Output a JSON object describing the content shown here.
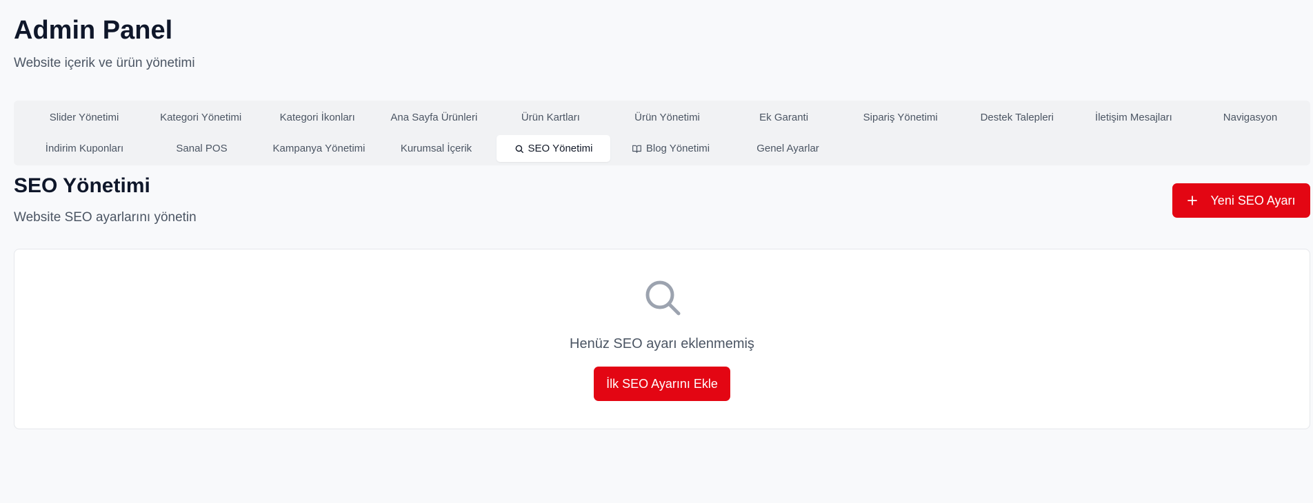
{
  "header": {
    "title": "Admin Panel",
    "subtitle": "Website içerik ve ürün yönetimi"
  },
  "tabs": {
    "row1": [
      {
        "label": "Slider Yönetimi"
      },
      {
        "label": "Kategori Yönetimi"
      },
      {
        "label": "Kategori İkonları"
      },
      {
        "label": "Ana Sayfa Ürünleri"
      },
      {
        "label": "Ürün Kartları"
      },
      {
        "label": "Ürün Yönetimi"
      },
      {
        "label": "Ek Garanti"
      },
      {
        "label": "Sipariş Yönetimi"
      },
      {
        "label": "Destek Talepleri"
      },
      {
        "label": "İletişim Mesajları"
      },
      {
        "label": "Navigasyon"
      }
    ],
    "row2": [
      {
        "label": "İndirim Kuponları"
      },
      {
        "label": "Sanal POS"
      },
      {
        "label": "Kampanya Yönetimi"
      },
      {
        "label": "Kurumsal İçerik"
      },
      {
        "label": "SEO Yönetimi",
        "icon": "search-icon",
        "active": true
      },
      {
        "label": "Blog Yönetimi",
        "icon": "book-icon"
      },
      {
        "label": "Genel Ayarlar"
      }
    ]
  },
  "section": {
    "title": "SEO Yönetimi",
    "subtitle": "Website SEO ayarlarını yönetin",
    "new_button_label": "Yeni SEO Ayarı",
    "new_button_icon": "plus-icon"
  },
  "empty_state": {
    "icon": "search-icon",
    "message": "Henüz SEO ayarı eklenmemiş",
    "button_label": "İlk SEO Ayarını Ekle"
  },
  "colors": {
    "accent": "#e30613",
    "background": "#f8f9fb",
    "tab_bar": "#f1f2f4",
    "muted_text": "#4b5563",
    "icon_gray": "#9ca3af"
  }
}
